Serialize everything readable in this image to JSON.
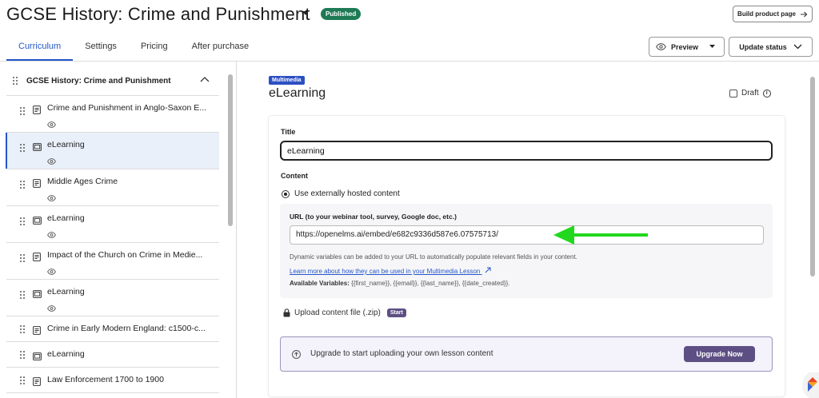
{
  "header": {
    "course_title": "GCSE History: Crime and Punishment",
    "status_badge": "Published",
    "build_button": "Build product page"
  },
  "tabs": [
    {
      "label": "Curriculum",
      "active": true
    },
    {
      "label": "Settings",
      "active": false
    },
    {
      "label": "Pricing",
      "active": false
    },
    {
      "label": "After purchase",
      "active": false
    }
  ],
  "actions": {
    "preview_label": "Preview",
    "update_status_label": "Update status"
  },
  "sidebar": {
    "section_title": "GCSE History: Crime and Punishment",
    "lessons": [
      {
        "label": "Crime and Punishment in Anglo-Saxon E...",
        "icon": "document-icon",
        "visible_icon": true
      },
      {
        "label": "eLearning",
        "icon": "multimedia-icon",
        "visible_icon": true,
        "selected": true
      },
      {
        "label": "Middle Ages Crime",
        "icon": "document-icon",
        "visible_icon": true
      },
      {
        "label": "eLearning",
        "icon": "multimedia-icon",
        "visible_icon": true
      },
      {
        "label": "Impact of the Church on Crime in Medie...",
        "icon": "document-icon",
        "visible_icon": true
      },
      {
        "label": "eLearning",
        "icon": "multimedia-icon",
        "visible_icon": true
      },
      {
        "label": "Crime in Early Modern England: c1500-c...",
        "icon": "document-icon",
        "visible_icon": false
      },
      {
        "label": "eLearning",
        "icon": "multimedia-icon",
        "visible_icon": false
      },
      {
        "label": "Law Enforcement 1700 to 1900",
        "icon": "document-icon",
        "visible_icon": false
      }
    ]
  },
  "lesson": {
    "type_badge": "Multimedia",
    "heading": "eLearning",
    "draft_label": "Draft",
    "title_label": "Title",
    "title_value": "eLearning",
    "content_label": "Content",
    "radio_label": "Use externally hosted content",
    "url_label": "URL (to your webinar tool, survey, Google doc, etc.)",
    "url_value": "https://openelms.ai/embed/e682c9336d587e6.07575713/",
    "help_text": "Dynamic variables can be added to your URL to automatically populate relevant fields in your content.",
    "help_link": "Learn more about how they can be used in your Multimedia Lesson",
    "variables_label": "Available Variables:",
    "variables_value": "{{first_name}}, {{email}}, {{last_name}}, {{date_created}}.",
    "upload_label": "Upload content file (.zip)",
    "start_badge": "Start",
    "upgrade_text": "Upgrade to start uploading your own lesson content",
    "upgrade_button": "Upgrade Now"
  },
  "colors": {
    "accent": "#2456c9",
    "published": "#1d7a55",
    "upgrade": "#5d4f84",
    "arrow": "#22d81e"
  }
}
